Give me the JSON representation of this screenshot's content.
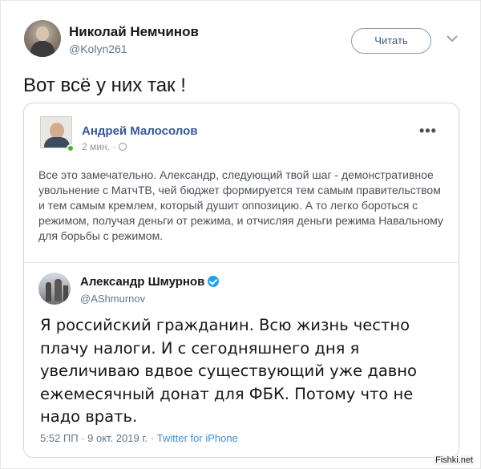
{
  "tweet": {
    "author_name": "Николай Немчинов",
    "author_handle": "@Kolyn261",
    "follow_label": "Читать",
    "text": "Вот всё у них так !"
  },
  "facebook_post": {
    "author_name": "Андрей Малосолов",
    "time": "2 мин. ·",
    "more": "•••",
    "text": "Все это замечательно. Александр, следующий твой шаг - демонстративное увольнение с МатчТВ, чей бюджет формируется тем самым правительством и тем самым кремлем, который душит оппозицию. А то легко бороться с режимом, получая деньги от режима, и отчисляя деньги режима Навальному для борьбы с режимом."
  },
  "quoted_tweet": {
    "author_name": "Александр Шмурнов",
    "author_handle": "@AShmurnov",
    "text": "Я российский гражданин. Всю жизнь честно плачу налоги. И с сегодняшнего дня я увеличиваю вдвое существующий уже давно ежемесячный донат для ФБК. Потому что не надо врать.",
    "timestamp": "5:52 ПП · 9 окт. 2019 г. · ",
    "source": "Twitter for iPhone"
  },
  "watermark": "Fishki.net",
  "colors": {
    "fb_link": "#365899",
    "twitter_blue": "#1da1f2",
    "muted": "#657786"
  }
}
